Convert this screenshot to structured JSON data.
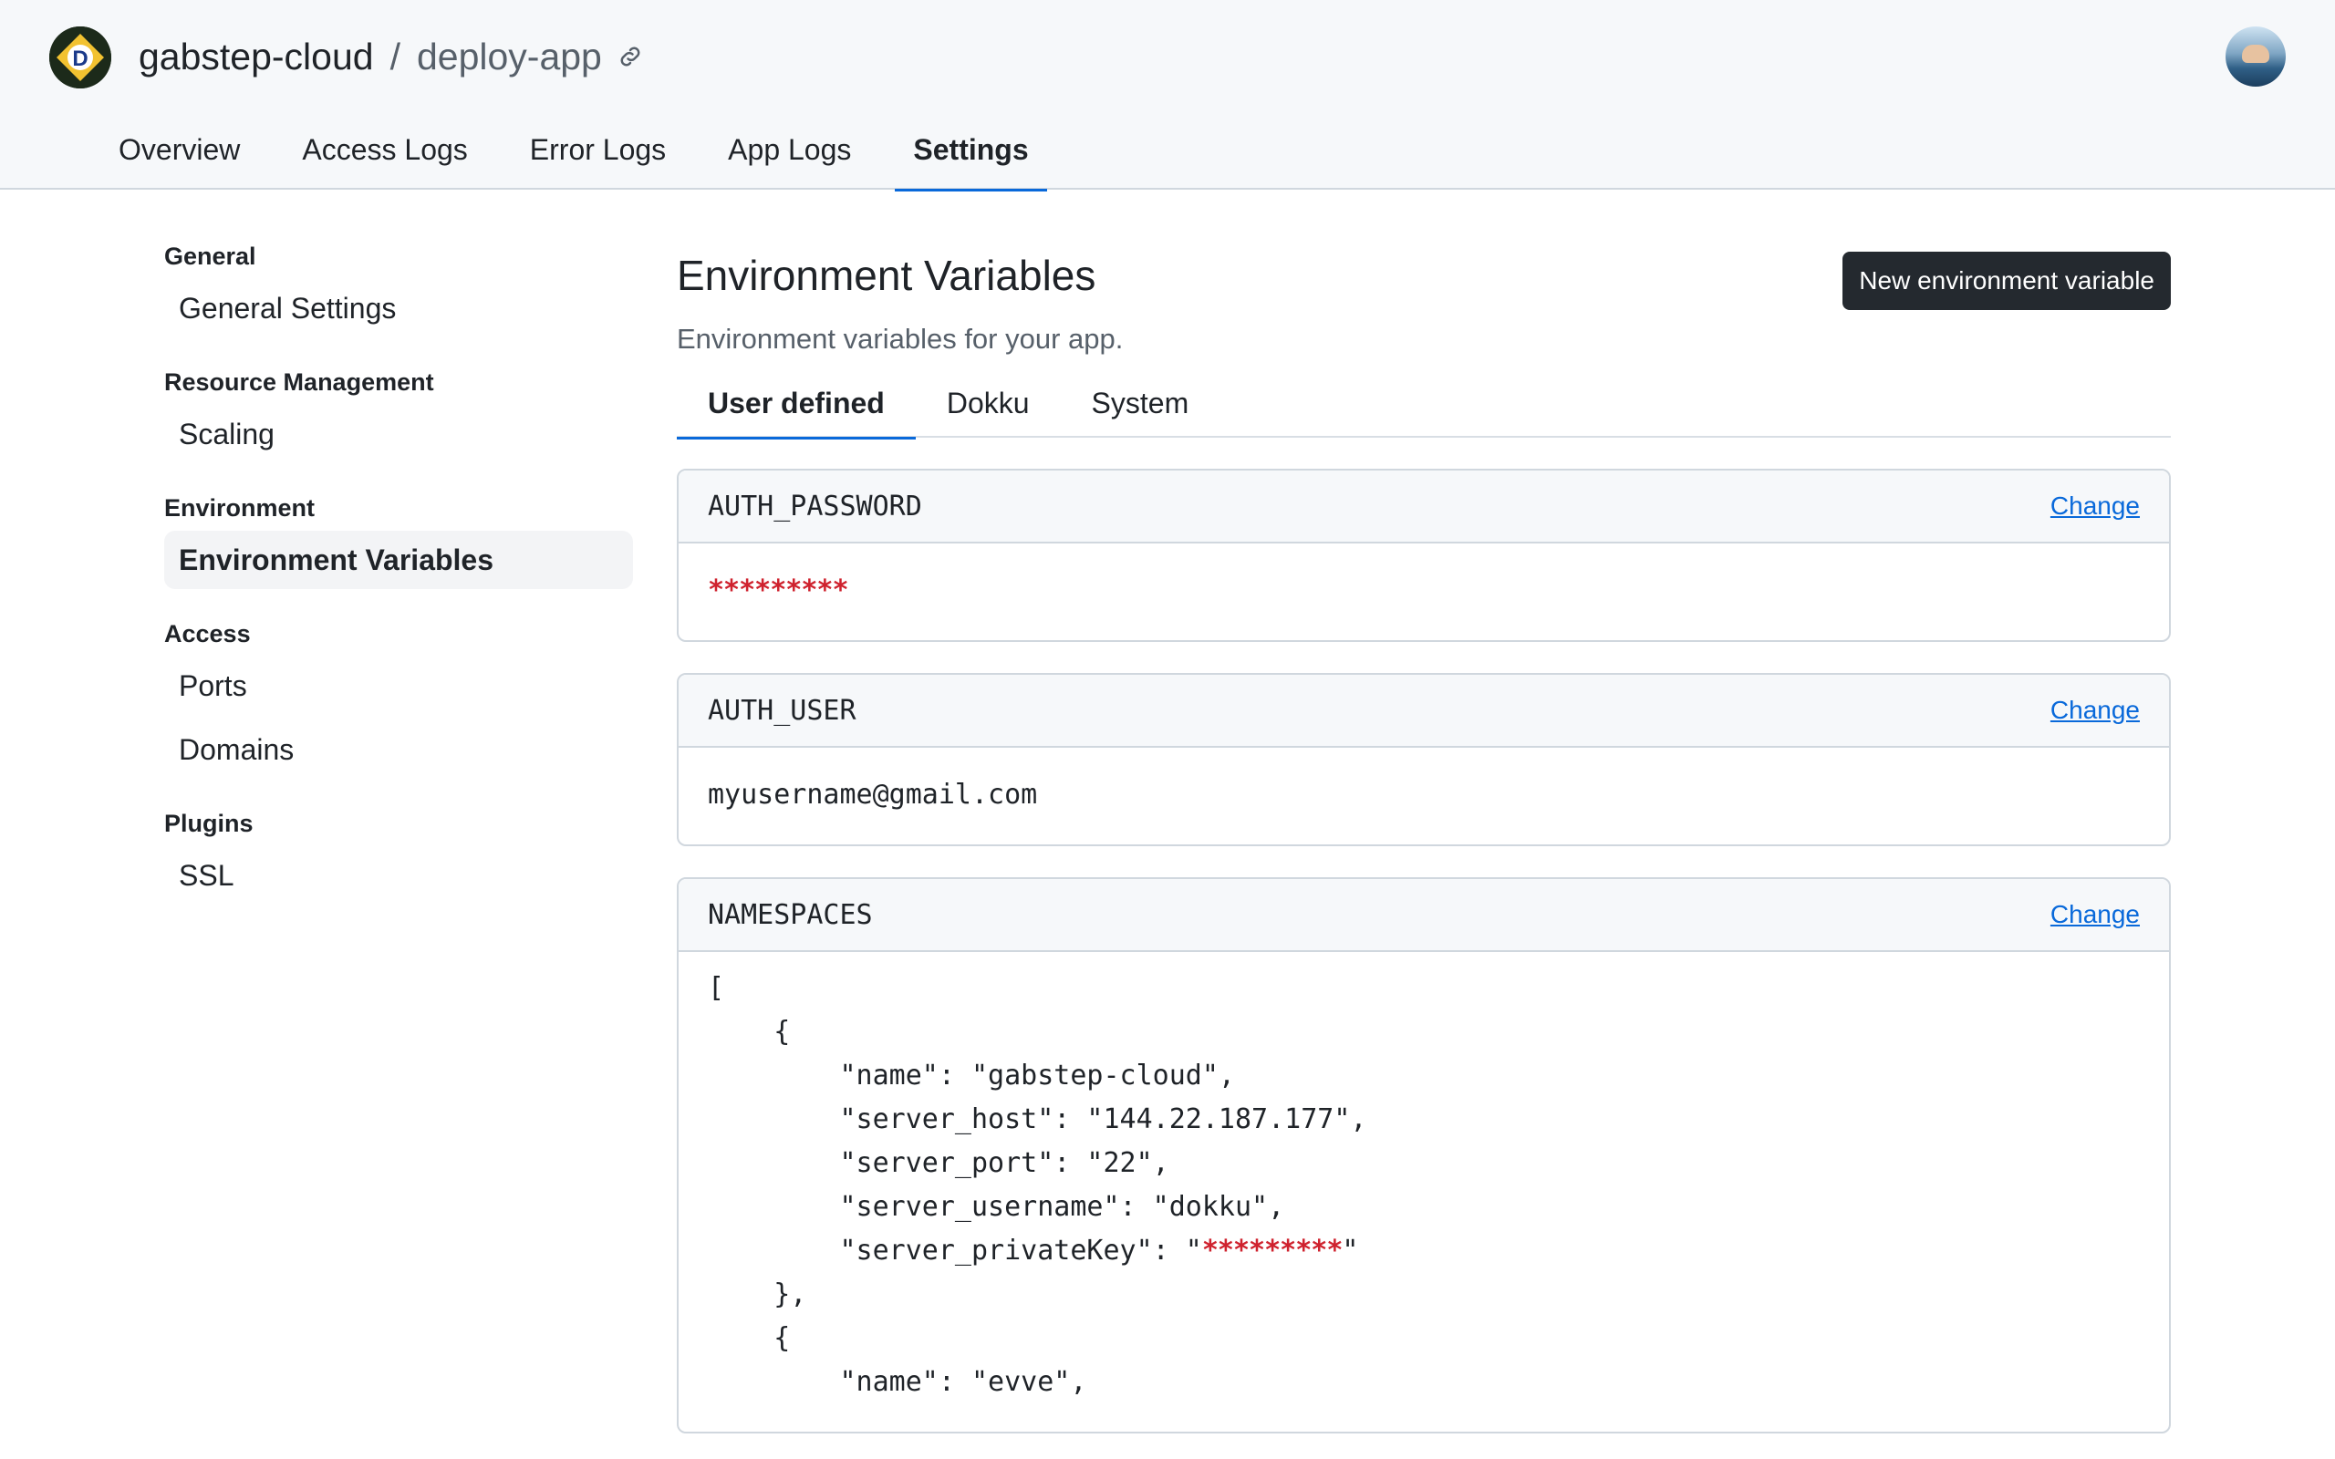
{
  "header": {
    "owner": "gabstep-cloud",
    "separator": "/",
    "app_name": "deploy-app",
    "icons": [
      "logo-icon",
      "link-icon",
      "avatar"
    ]
  },
  "topnav": {
    "items": [
      {
        "label": "Overview"
      },
      {
        "label": "Access Logs"
      },
      {
        "label": "Error Logs"
      },
      {
        "label": "App Logs"
      },
      {
        "label": "Settings",
        "active": true
      }
    ]
  },
  "sidebar": {
    "groups": [
      {
        "heading": "General",
        "items": [
          {
            "label": "General Settings"
          }
        ]
      },
      {
        "heading": "Resource Management",
        "items": [
          {
            "label": "Scaling"
          }
        ]
      },
      {
        "heading": "Environment",
        "items": [
          {
            "label": "Environment Variables",
            "active": true
          }
        ]
      },
      {
        "heading": "Access",
        "items": [
          {
            "label": "Ports"
          },
          {
            "label": "Domains"
          }
        ]
      },
      {
        "heading": "Plugins",
        "items": [
          {
            "label": "SSL"
          }
        ]
      }
    ]
  },
  "main": {
    "title": "Environment Variables",
    "subtitle": "Environment variables for your app.",
    "new_button": "New environment variable",
    "tabs": [
      {
        "label": "User defined",
        "active": true
      },
      {
        "label": "Dokku"
      },
      {
        "label": "System"
      }
    ],
    "change_label": "Change",
    "variables": [
      {
        "key": "AUTH_PASSWORD",
        "value": "*********"
      },
      {
        "key": "AUTH_USER",
        "value": "myusername@gmail.com"
      },
      {
        "key": "NAMESPACES",
        "value_lines": [
          "[",
          "    {",
          "        \"name\": \"gabstep-cloud\",",
          "",
          "        \"server_host\": \"144.22.187.177\",",
          "        \"server_port\": \"22\",",
          "        \"server_username\": \"dokku\",",
          "        \"server_privateKey\": \"",
          "    },",
          "    {",
          "        \"name\": \"evve\","
        ],
        "masked_key_value": "*********",
        "masked_key_suffix": "\""
      }
    ]
  },
  "colors": {
    "accent": "#0969da",
    "masked": "#cf222e",
    "button_bg": "#24292f",
    "header_bg": "#f6f8fa"
  }
}
